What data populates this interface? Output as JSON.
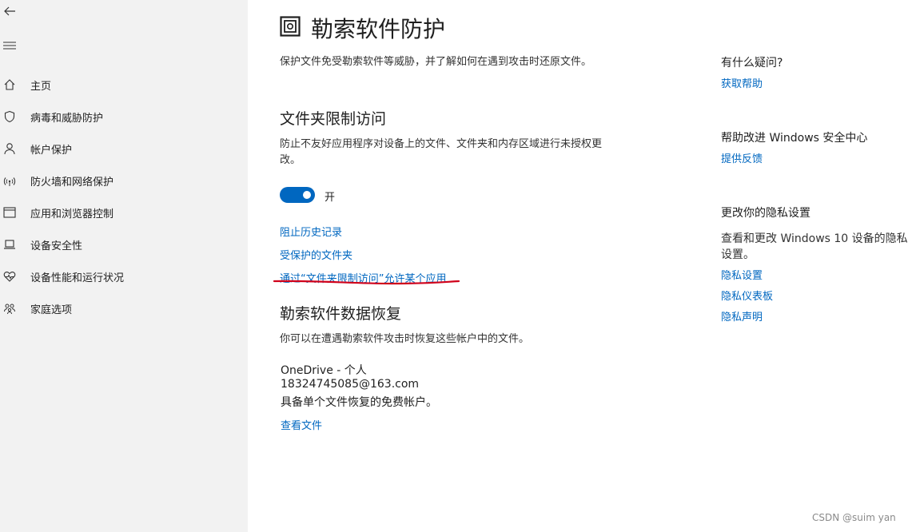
{
  "sidebar": {
    "items": [
      {
        "label": "主页",
        "icon": "home-icon"
      },
      {
        "label": "病毒和威胁防护",
        "icon": "shield-icon"
      },
      {
        "label": "帐户保护",
        "icon": "person-icon"
      },
      {
        "label": "防火墙和网络保护",
        "icon": "wifi-icon"
      },
      {
        "label": "应用和浏览器控制",
        "icon": "browser-icon"
      },
      {
        "label": "设备安全性",
        "icon": "laptop-icon"
      },
      {
        "label": "设备性能和运行状况",
        "icon": "heart-icon"
      },
      {
        "label": "家庭选项",
        "icon": "family-icon"
      }
    ]
  },
  "main": {
    "title": "勒索软件防护",
    "subtitle": "保护文件免受勒索软件等威胁，并了解如何在遇到攻击时还原文件。",
    "cfa": {
      "title": "文件夹限制访问",
      "description_line1": "防止不友好应用程序对设备上的文件、文件夹和内存区域进行未授权更",
      "description_line2": "改。",
      "toggle_state": "开",
      "links": [
        "阻止历史记录",
        "受保护的文件夹",
        "通过“文件夹限制访问”允许某个应用"
      ]
    },
    "recovery": {
      "title": "勒索软件数据恢复",
      "description": "你可以在遭遇勒索软件攻击时恢复这些帐户中的文件。",
      "account_name": "OneDrive - 个人",
      "account_email": "18324745085@163.com",
      "account_desc": "具备单个文件恢复的免费帐户。",
      "view_files": "查看文件"
    }
  },
  "right_panel": {
    "question_title": "有什么疑问?",
    "get_help": "获取帮助",
    "improve_title": "帮助改进 Windows 安全中心",
    "feedback": "提供反馈",
    "privacy_title": "更改你的隐私设置",
    "privacy_desc_line1": "查看和更改 Windows 10 设备的隐私",
    "privacy_desc_line2": "设置。",
    "privacy_links": [
      "隐私设置",
      "隐私仪表板",
      "隐私声明"
    ]
  },
  "watermark": "CSDN @suim yan",
  "colors": {
    "accent": "#0067c0",
    "annotation": "#d0021b"
  }
}
